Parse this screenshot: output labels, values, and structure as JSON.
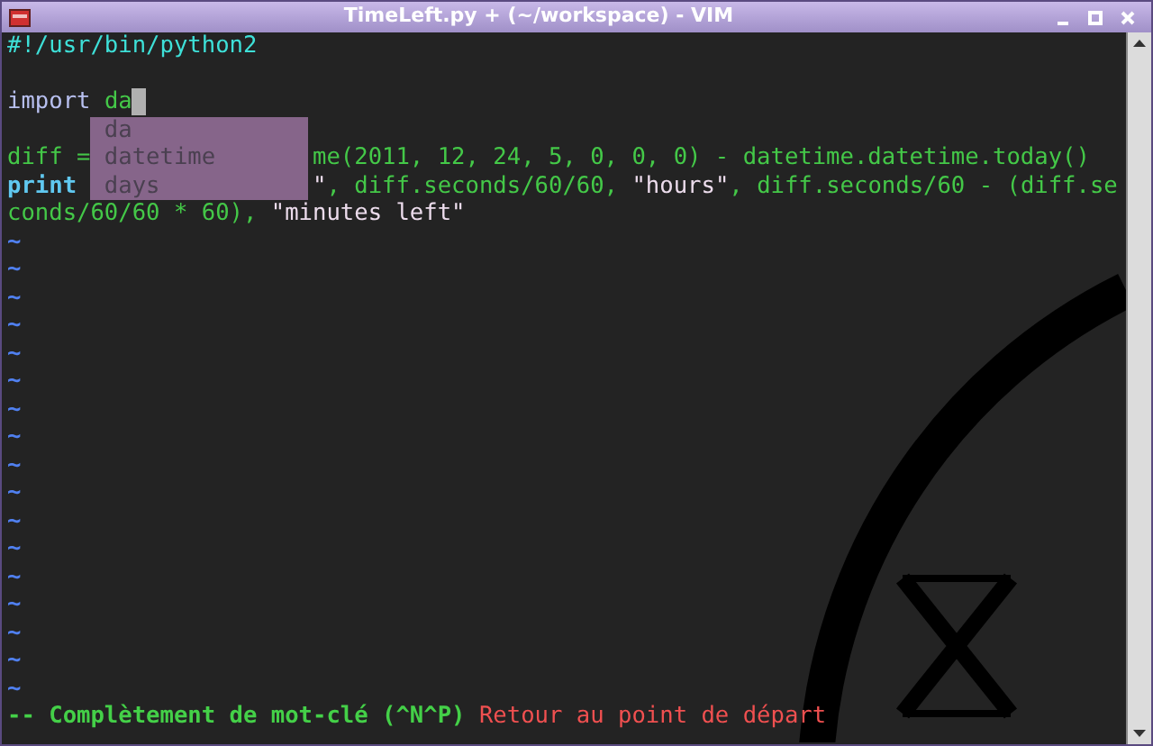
{
  "window": {
    "title": "TimeLeft.py + (~/workspace) - VIM"
  },
  "lines": [
    {
      "segments": [
        {
          "text": "#!/usr/bin/python2",
          "kind": "comment"
        }
      ]
    },
    {
      "segments": [
        {
          "kind": "blank"
        }
      ]
    },
    {
      "segments": [
        {
          "text": "import",
          "kind": "keyword"
        },
        {
          "kind": "space"
        },
        {
          "text": "da",
          "kind": "identifier"
        },
        {
          "kind": "cursor"
        }
      ]
    },
    {
      "segments": [
        {
          "kind": "blank"
        }
      ]
    },
    {
      "segments": [
        {
          "text": "diff =",
          "kind": "identifier"
        },
        {
          "kind": "covered"
        },
        {
          "text": "me(2011, 12, 24, 5, 0, 0, 0) - datetime.datetime.today()",
          "kind": "identifier"
        }
      ]
    },
    {
      "segments": [
        {
          "text": "print",
          "kind": "statement"
        },
        {
          "kind": "space"
        },
        {
          "kind": "covered"
        },
        {
          "text": "\"",
          "kind": "string"
        },
        {
          "text": ", diff.seconds/60/60, ",
          "kind": "identifier"
        },
        {
          "text": "\"hours\"",
          "kind": "string"
        },
        {
          "text": ", diff.seconds/60 - (diff.se",
          "kind": "identifier"
        }
      ]
    },
    {
      "segments": [
        {
          "text": "conds/60/60 * 60), ",
          "kind": "identifier"
        },
        {
          "text": "\"minutes left\"",
          "kind": "string"
        }
      ]
    }
  ],
  "tildes": [
    "~",
    "~",
    "~",
    "~",
    "~",
    "~",
    "~",
    "~",
    "~",
    "~",
    "~",
    "~",
    "~",
    "~",
    "~",
    "~",
    "~"
  ],
  "completion_menu": {
    "items": [
      "da",
      "datetime",
      "days"
    ]
  },
  "status_line": {
    "mode": "-- Complètement de mot-clé (^N^P)",
    "message": "Retour au point de départ"
  }
}
